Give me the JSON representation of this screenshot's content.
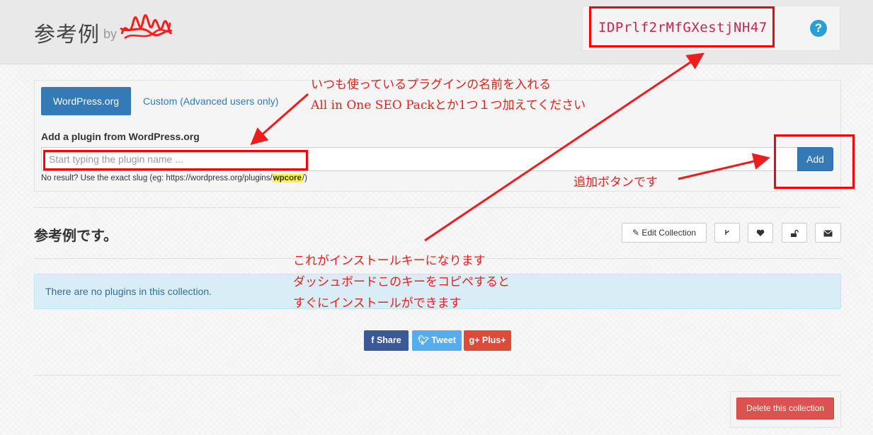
{
  "header": {
    "title": "参考例",
    "by": "by",
    "install_key": "IDPrlf2rMfGXestjNH47",
    "help": "?"
  },
  "panel": {
    "tabs": [
      {
        "label": "WordPress.org"
      },
      {
        "label": "Custom (Advanced users only)"
      }
    ],
    "heading": "Add a plugin from WordPress.org",
    "input_placeholder": "Start typing the plugin name ...",
    "add_label": "Add",
    "hint_prefix": "No result? Use the exact slug (eg: https://wordpress.org/plugins/",
    "hint_slug": "wpcore",
    "hint_suffix": "/)"
  },
  "collection": {
    "title": "参考例です。",
    "edit_label": "Edit Collection",
    "fork_icon": "fork-icon",
    "heart_icon": "heart-icon",
    "lock_icon": "unlock-icon",
    "mail_icon": "envelope-icon",
    "empty_message": "There are no plugins in this collection."
  },
  "share": {
    "facebook": "Share",
    "twitter": "Tweet",
    "google": "Plus+"
  },
  "delete_label": "Delete this collection",
  "annotations": {
    "plugin_line1": "いつも使っているプラグインの名前を入れる",
    "plugin_line2": "All in One SEO Packとか1つ１つ加えてください",
    "add_note": "追加ボタンです",
    "key_line1": "これがインストールキーになります",
    "key_line2": "ダッシュボードこのキーをコピペすると",
    "key_line3": "すぐにインストールができます"
  },
  "colors": {
    "primary": "#337ab7",
    "danger": "#d9534f",
    "annotation": "#e8201c",
    "key_text": "#c7254e"
  }
}
